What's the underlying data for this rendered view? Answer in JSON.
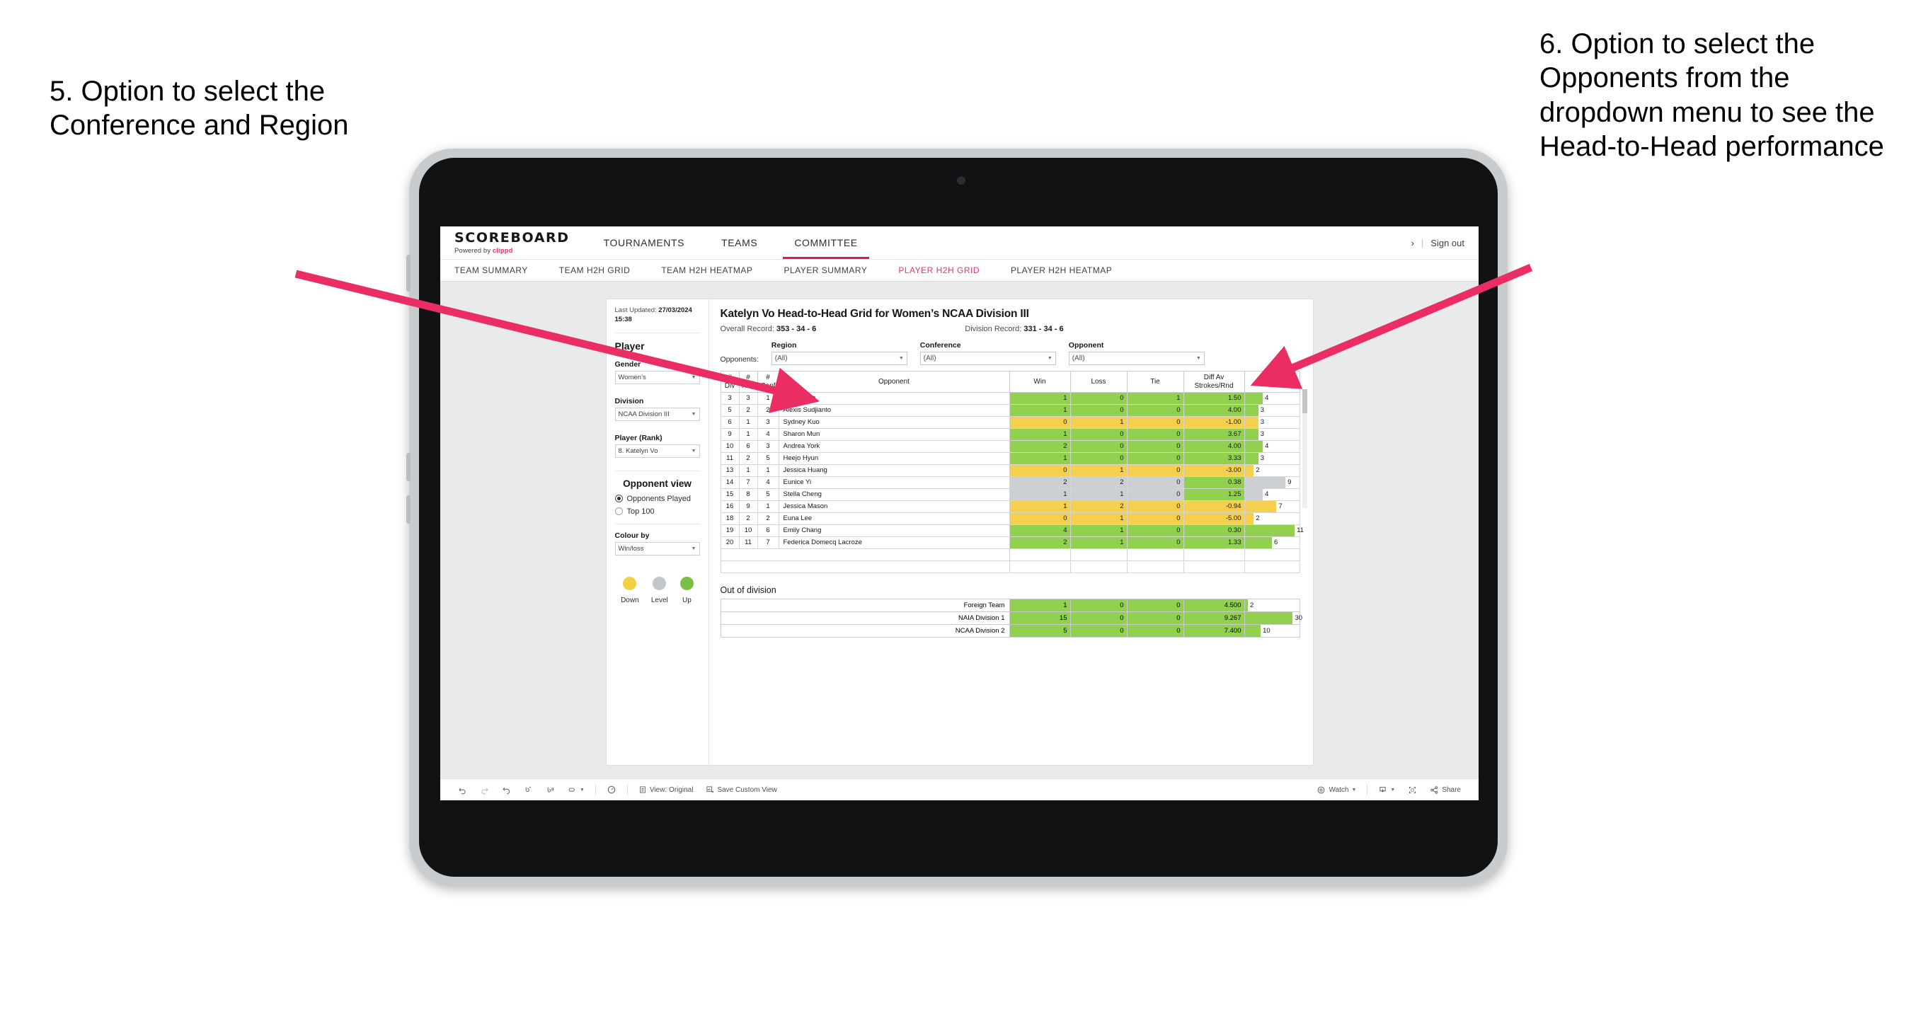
{
  "annotations": {
    "left": "5. Option to select the Conference and Region",
    "right": "6. Option to select the Opponents from the dropdown menu to see the Head-to-Head performance"
  },
  "brand": {
    "title": "SCOREBOARD",
    "powered_prefix": "Powered by ",
    "powered_name": "clippd",
    "accent": "#ec2d62"
  },
  "topnav": {
    "items": [
      {
        "label": "TOURNAMENTS",
        "active": false
      },
      {
        "label": "TEAMS",
        "active": false
      },
      {
        "label": "COMMITTEE",
        "active": true
      }
    ],
    "chevron": "›",
    "separator": "|",
    "sign_out": "Sign out"
  },
  "subnav": {
    "items": [
      {
        "label": "TEAM SUMMARY",
        "active": false
      },
      {
        "label": "TEAM H2H GRID",
        "active": false
      },
      {
        "label": "TEAM H2H HEATMAP",
        "active": false
      },
      {
        "label": "PLAYER SUMMARY",
        "active": false
      },
      {
        "label": "PLAYER H2H GRID",
        "active": true
      },
      {
        "label": "PLAYER H2H HEATMAP",
        "active": false
      }
    ],
    "active_color": "#e8376b"
  },
  "sidebar": {
    "last_updated_label": "Last Updated: ",
    "last_updated_value": "27/03/2024",
    "last_updated_time": "15:38",
    "player_heading": "Player",
    "gender_label": "Gender",
    "gender_value": "Women’s",
    "division_label": "Division",
    "division_value": "NCAA Division III",
    "player_rank_label": "Player (Rank)",
    "player_rank_value": "8. Katelyn Vo",
    "opponent_view_heading": "Opponent view",
    "opponent_view_options": [
      {
        "label": "Opponents Played",
        "selected": true
      },
      {
        "label": "Top 100",
        "selected": false
      }
    ],
    "colour_by_label": "Colour by",
    "colour_by_value": "Win/loss",
    "legend": [
      {
        "label": "Down",
        "color": "#f2d03f"
      },
      {
        "label": "Level",
        "color": "#c3c7cb"
      },
      {
        "label": "Up",
        "color": "#7ac143"
      }
    ]
  },
  "main": {
    "title": "Katelyn Vo Head-to-Head Grid for Women’s NCAA Division III",
    "overall_record_label": "Overall Record: ",
    "overall_record_value": "353 - 34 - 6",
    "division_record_label": "Division Record: ",
    "division_record_value": "331 - 34 - 6",
    "opponents_label": "Opponents:",
    "filters": [
      {
        "label": "Region",
        "value": "(All)"
      },
      {
        "label": "Conference",
        "value": "(All)"
      },
      {
        "label": "Opponent",
        "value": "(All)"
      }
    ]
  },
  "chart_data": {
    "type": "table",
    "title": "Katelyn Vo Head-to-Head Grid for Women’s NCAA Division III",
    "columns": [
      "# Div",
      "# Reg",
      "# Conf",
      "Opponent",
      "Win",
      "Loss",
      "Tie",
      "Diff Av Strokes/Rnd",
      "Rounds"
    ],
    "header_lines": [
      [
        "#",
        "Div"
      ],
      [
        "#",
        "Reg"
      ],
      [
        "#",
        "Conf"
      ],
      [
        "Opponent"
      ],
      [
        "Win"
      ],
      [
        "Loss"
      ],
      [
        "Tie"
      ],
      [
        "Diff Av",
        "Strokes/Rnd"
      ],
      [
        "Rounds"
      ]
    ],
    "rounds_max": 12,
    "rows": [
      {
        "div": "3",
        "reg": "3",
        "conf": "1",
        "opponent": "Esther Lee",
        "win": "1",
        "loss": "0",
        "tie": "1",
        "diff": "1.50",
        "rounds": "4",
        "color": "green"
      },
      {
        "div": "5",
        "reg": "2",
        "conf": "2",
        "opponent": "Alexis Sudjianto",
        "win": "1",
        "loss": "0",
        "tie": "0",
        "diff": "4.00",
        "rounds": "3",
        "color": "green"
      },
      {
        "div": "6",
        "reg": "1",
        "conf": "3",
        "opponent": "Sydney Kuo",
        "win": "0",
        "loss": "1",
        "tie": "0",
        "diff": "-1.00",
        "rounds": "3",
        "color": "yellow"
      },
      {
        "div": "9",
        "reg": "1",
        "conf": "4",
        "opponent": "Sharon Mun",
        "win": "1",
        "loss": "0",
        "tie": "0",
        "diff": "3.67",
        "rounds": "3",
        "color": "green"
      },
      {
        "div": "10",
        "reg": "6",
        "conf": "3",
        "opponent": "Andrea York",
        "win": "2",
        "loss": "0",
        "tie": "0",
        "diff": "4.00",
        "rounds": "4",
        "color": "green"
      },
      {
        "div": "11",
        "reg": "2",
        "conf": "5",
        "opponent": "Heejo Hyun",
        "win": "1",
        "loss": "0",
        "tie": "0",
        "diff": "3.33",
        "rounds": "3",
        "color": "green"
      },
      {
        "div": "13",
        "reg": "1",
        "conf": "1",
        "opponent": "Jessica Huang",
        "win": "0",
        "loss": "1",
        "tie": "0",
        "diff": "-3.00",
        "rounds": "2",
        "color": "yellow"
      },
      {
        "div": "14",
        "reg": "7",
        "conf": "4",
        "opponent": "Eunice Yi",
        "win": "2",
        "loss": "2",
        "tie": "0",
        "diff": "0.38",
        "rounds": "9",
        "color": "grey",
        "diff_color": "green"
      },
      {
        "div": "15",
        "reg": "8",
        "conf": "5",
        "opponent": "Stella Cheng",
        "win": "1",
        "loss": "1",
        "tie": "0",
        "diff": "1.25",
        "rounds": "4",
        "color": "grey",
        "diff_color": "green"
      },
      {
        "div": "16",
        "reg": "9",
        "conf": "1",
        "opponent": "Jessica Mason",
        "win": "1",
        "loss": "2",
        "tie": "0",
        "diff": "-0.94",
        "rounds": "7",
        "color": "yellow"
      },
      {
        "div": "18",
        "reg": "2",
        "conf": "2",
        "opponent": "Euna Lee",
        "win": "0",
        "loss": "1",
        "tie": "0",
        "diff": "-5.00",
        "rounds": "2",
        "color": "yellow"
      },
      {
        "div": "19",
        "reg": "10",
        "conf": "6",
        "opponent": "Emily Chang",
        "win": "4",
        "loss": "1",
        "tie": "0",
        "diff": "0.30",
        "rounds": "11",
        "color": "green"
      },
      {
        "div": "20",
        "reg": "11",
        "conf": "7",
        "opponent": "Federica Domecq Lacroze",
        "win": "2",
        "loss": "1",
        "tie": "0",
        "diff": "1.33",
        "rounds": "6",
        "color": "green"
      }
    ],
    "out_of_division_heading": "Out of division",
    "out_of_division_rounds_max": 34,
    "out_of_division": [
      {
        "name": "Foreign Team",
        "win": "1",
        "loss": "0",
        "tie": "0",
        "diff": "4.500",
        "rounds": "2",
        "color": "green"
      },
      {
        "name": "NAIA Division 1",
        "win": "15",
        "loss": "0",
        "tie": "0",
        "diff": "9.267",
        "rounds": "30",
        "color": "green"
      },
      {
        "name": "NCAA Division 2",
        "win": "5",
        "loss": "0",
        "tie": "0",
        "diff": "7.400",
        "rounds": "10",
        "color": "green"
      }
    ]
  },
  "toolbar": {
    "undo": "undo-icon",
    "redo": "redo-icon",
    "revert": "revert-icon",
    "refresh": "refresh-icon",
    "pause": "pause-icon",
    "view_original": "View: Original",
    "save_custom_view": "Save Custom View",
    "watch": "Watch",
    "share": "Share",
    "download": "download-icon",
    "fullscreen": "fullscreen-icon"
  }
}
